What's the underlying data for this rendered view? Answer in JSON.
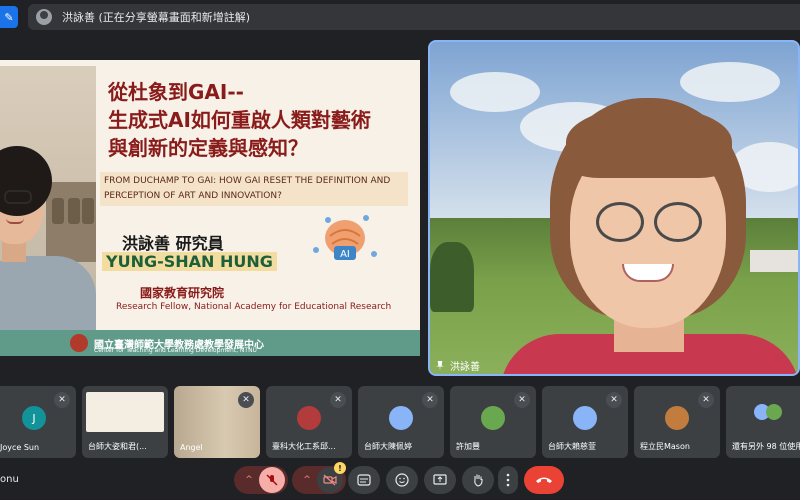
{
  "top_bar": {
    "presenting_text": "洪詠善 (正在分享螢幕畫面和新增註解)"
  },
  "slide": {
    "title_lines": [
      "從杜象到GAI--",
      "生成式AI如何重啟人類對藝術",
      "與創新的定義與感知？"
    ],
    "subtitle_en": "FROM DUCHAMP TO GAI: HOW GAI RESET THE DEFINITION AND PERCEPTION OF ART AND INNOVATION?",
    "speaker_cn": "洪詠善  研究員",
    "speaker_en": "YUNG-SHAN HUNG",
    "institution_cn": "國家教育研究院",
    "role_en": "Research Fellow, National Academy for Educational Research",
    "brain_text": "AI",
    "footer_cn": "國立臺灣師範大學教務處教學發展中心",
    "footer_en": "Center for Teaching and Learning Development, NTNU"
  },
  "speaker_tile": {
    "name": "洪詠善"
  },
  "participants": [
    {
      "name": "Joyce Sun",
      "initial": "J",
      "avatar_color": "#12939a"
    },
    {
      "name": "台師大姿和君(...",
      "initial": "",
      "avatar_color": ""
    },
    {
      "name": "Angel",
      "initial": "",
      "avatar_color": ""
    },
    {
      "name": "臺科大化工系邱...",
      "initial": "",
      "avatar_color": "#b23b3b"
    },
    {
      "name": "台師大陳佩婷",
      "initial": "",
      "avatar_color": "#8ab4f8"
    },
    {
      "name": "許加豐",
      "initial": "",
      "avatar_color": "#6aa84f"
    },
    {
      "name": "台師大賴慈萱",
      "initial": "",
      "avatar_color": "#8ab4f8"
    },
    {
      "name": "程立民Mason",
      "initial": "",
      "avatar_color": "#c27c3e"
    },
    {
      "name": "還有另外 98 位使用",
      "initial": "",
      "avatar_color": ""
    }
  ],
  "bottom": {
    "self_label": "onu",
    "mic_arrow": "^",
    "cam_arrow": "^",
    "warning_badge": "!",
    "captions_icon": "cc-icon",
    "emoji_icon": "emoji-icon",
    "present_icon": "present-icon",
    "hand_icon": "raise-hand-icon",
    "more_icon": "more-icon",
    "hangup_icon": "hangup-icon"
  },
  "colors": {
    "background": "#202124",
    "tile": "#3c4043",
    "accent": "#8ab4f8",
    "hangup": "#ea4335"
  }
}
